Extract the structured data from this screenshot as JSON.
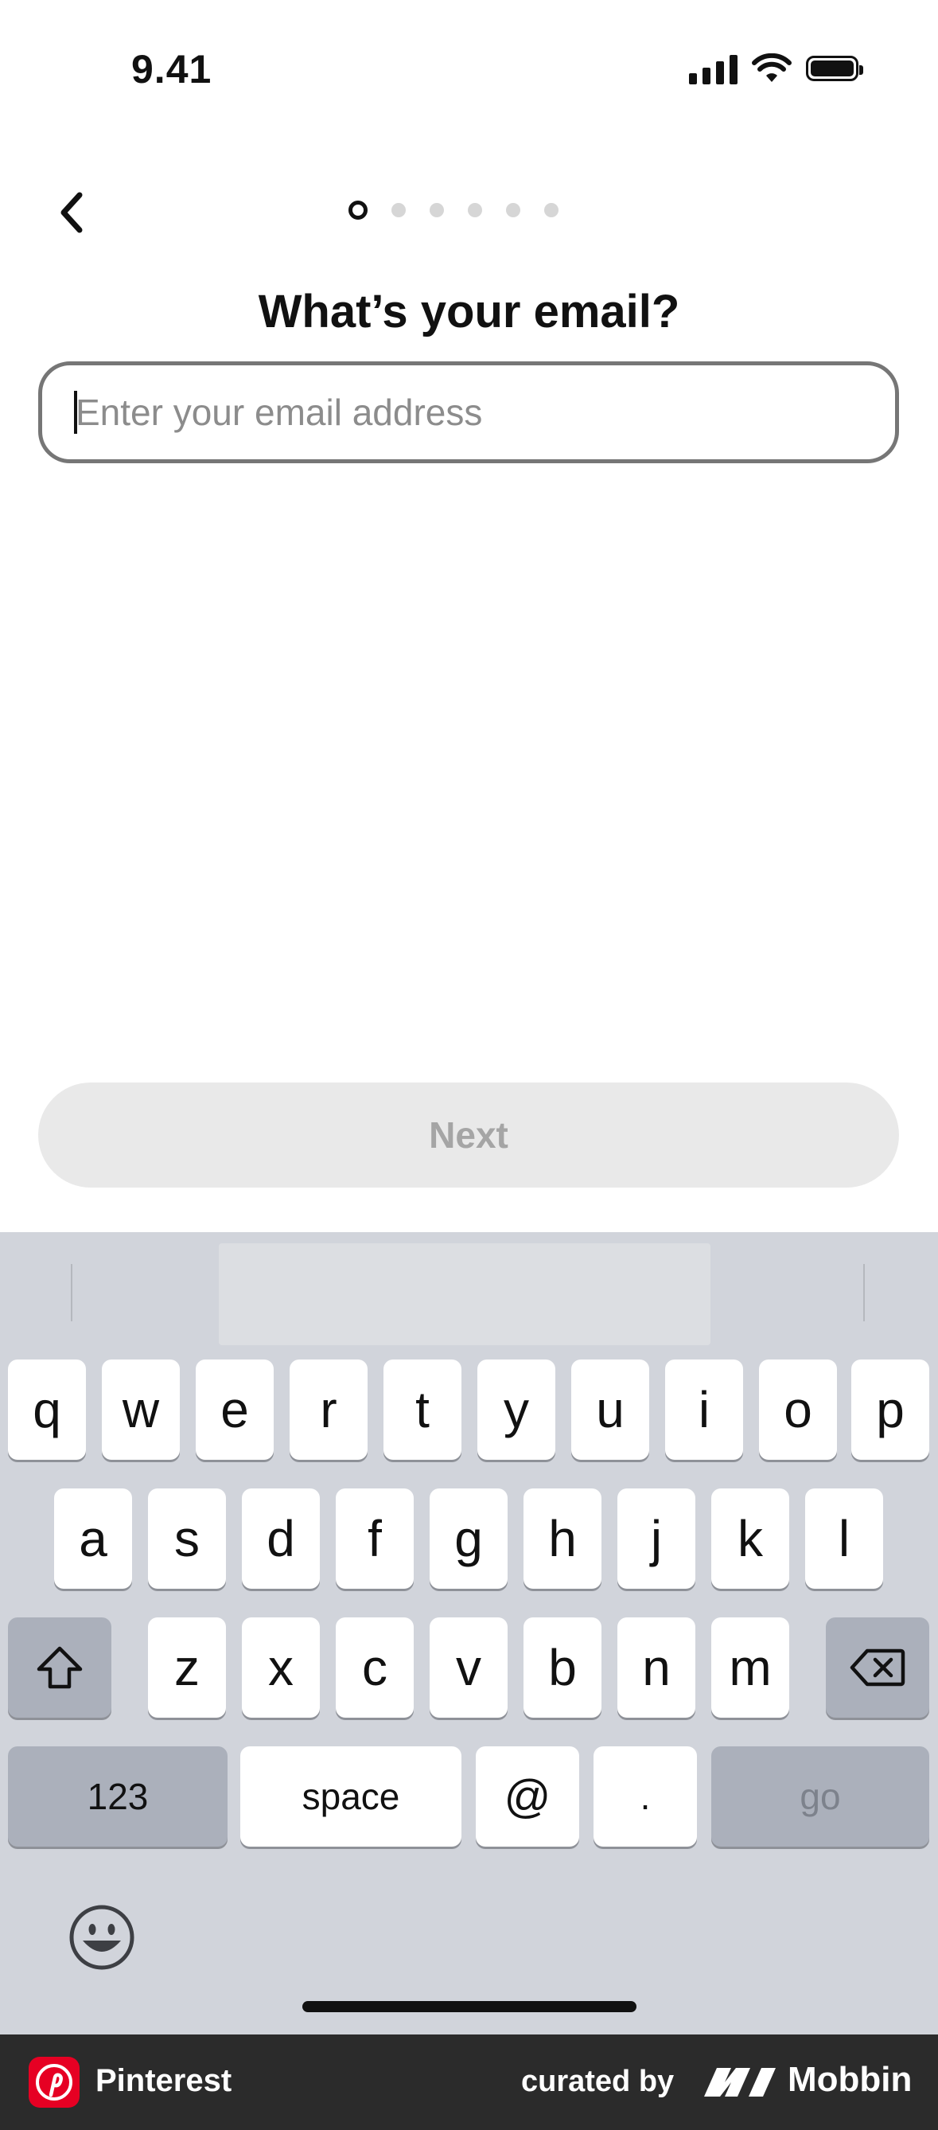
{
  "status_bar": {
    "time": "9.41"
  },
  "progress": {
    "total_steps": 6,
    "current_step": 1
  },
  "title": "What’s your email?",
  "email": {
    "placeholder": "Enter your email address",
    "value": ""
  },
  "next_button": {
    "label": "Next"
  },
  "keyboard": {
    "row1": [
      "q",
      "w",
      "e",
      "r",
      "t",
      "y",
      "u",
      "i",
      "o",
      "p"
    ],
    "row2": [
      "a",
      "s",
      "d",
      "f",
      "g",
      "h",
      "j",
      "k",
      "l"
    ],
    "row3": [
      "z",
      "x",
      "c",
      "v",
      "b",
      "n",
      "m"
    ],
    "numbers_key": "123",
    "space_key": "space",
    "at_key": "@",
    "dot_key": ".",
    "go_key": "go"
  },
  "footer": {
    "app_name": "Pinterest",
    "curated_by": "curated by",
    "brand": "Mobbin"
  },
  "colors": {
    "pinterest_red": "#e60023",
    "keyboard_bg": "#d1d4db",
    "button_disabled": "#e9e9e9"
  }
}
